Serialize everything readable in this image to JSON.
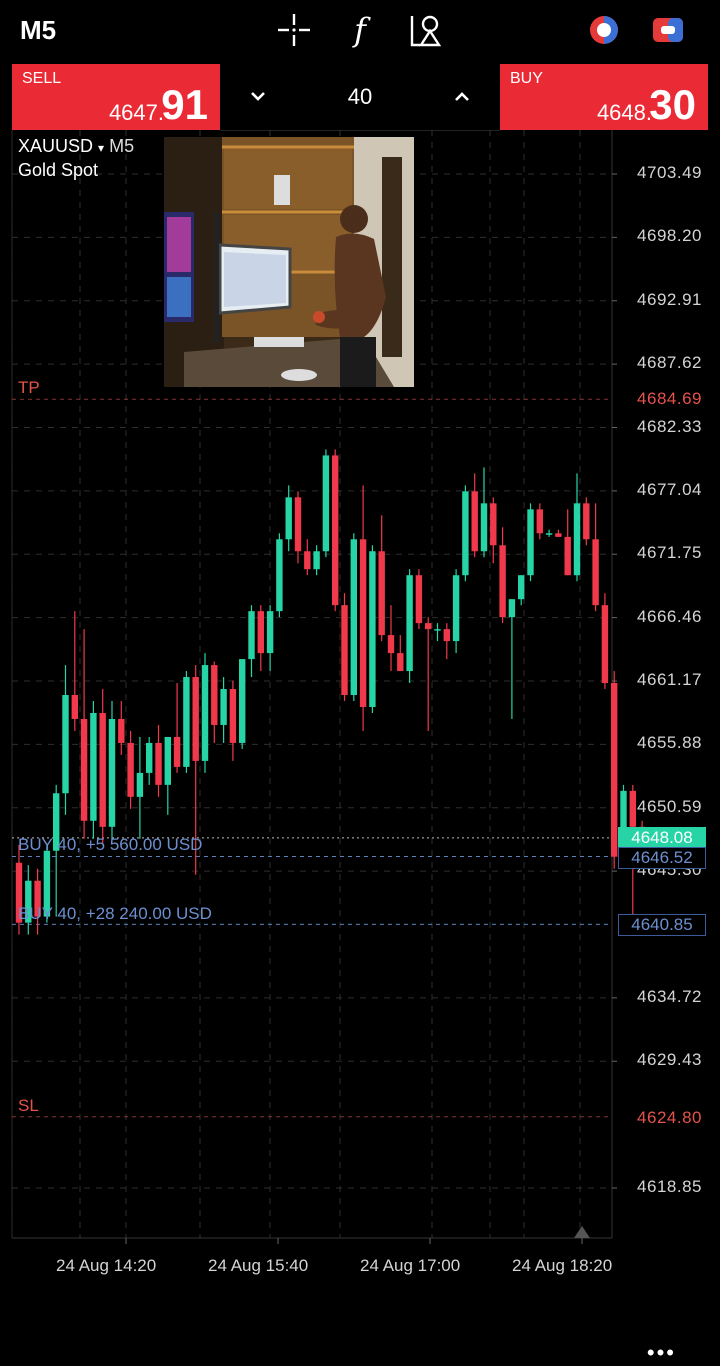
{
  "toolbar": {
    "timeframe": "M5",
    "icons": [
      "crosshair-icon",
      "indicators-icon",
      "objects-icon",
      "one-click-trading-icon",
      "chart-toggle-icon"
    ],
    "indicator_glyph": "f"
  },
  "trade_panel": {
    "sell": {
      "label": "SELL",
      "price_main": "4647.",
      "price_big": "91"
    },
    "buy": {
      "label": "BUY",
      "price_main": "4648.",
      "price_big": "30"
    },
    "volume": "40"
  },
  "chart": {
    "symbol": "XAUUSD",
    "symbol_caret": "▾",
    "period": "M5",
    "description": "Gold Spot",
    "price_axis": [
      "4703.49",
      "4698.20",
      "4692.91",
      "4687.62",
      "4682.33",
      "4677.04",
      "4671.75",
      "4666.46",
      "4661.17",
      "4655.88",
      "4650.59",
      "4645.30",
      "4634.72",
      "4629.43",
      "4618.85"
    ],
    "time_axis": [
      "24 Aug 14:20",
      "24 Aug 15:40",
      "24 Aug 17:00",
      "24 Aug 18:20"
    ],
    "levels": {
      "tp": {
        "label": "TP",
        "price": "4684.69"
      },
      "sl": {
        "label": "SL",
        "price": "4624.80"
      },
      "position1": {
        "label": "BUY 40, +5 560.00 USD",
        "price": "4646.52"
      },
      "position2": {
        "label": "BUY 40, +28 240.00 USD",
        "price": "4640.85"
      },
      "current": {
        "price": "4648.08"
      }
    },
    "colors": {
      "bull": "#26d4a6",
      "bear": "#f0394a",
      "tp_sl": "#e5534b",
      "position": "#5b7fbf"
    },
    "more": "•••"
  },
  "chart_data": {
    "type": "candlestick",
    "title": "XAUUSD",
    "subtitle": "Gold Spot",
    "timeframe": "M5",
    "ylim": [
      4615.0,
      4706.0
    ],
    "candles": [
      {
        "o": 4646.0,
        "h": 4647.5,
        "l": 4640.0,
        "c": 4641.0
      },
      {
        "o": 4641.0,
        "h": 4645.8,
        "l": 4640.0,
        "c": 4644.5
      },
      {
        "o": 4644.5,
        "h": 4645.5,
        "l": 4640.0,
        "c": 4641.5
      },
      {
        "o": 4641.5,
        "h": 4647.5,
        "l": 4641.0,
        "c": 4647.0
      },
      {
        "o": 4647.0,
        "h": 4652.5,
        "l": 4641.5,
        "c": 4651.8
      },
      {
        "o": 4651.8,
        "h": 4662.5,
        "l": 4650.0,
        "c": 4660.0
      },
      {
        "o": 4660.0,
        "h": 4667.0,
        "l": 4657.0,
        "c": 4658.0
      },
      {
        "o": 4658.0,
        "h": 4665.5,
        "l": 4648.0,
        "c": 4649.5
      },
      {
        "o": 4649.5,
        "h": 4659.5,
        "l": 4648.0,
        "c": 4658.5
      },
      {
        "o": 4658.5,
        "h": 4660.5,
        "l": 4647.5,
        "c": 4649.0
      },
      {
        "o": 4649.0,
        "h": 4659.5,
        "l": 4648.0,
        "c": 4658.0
      },
      {
        "o": 4658.0,
        "h": 4659.5,
        "l": 4655.0,
        "c": 4656.0
      },
      {
        "o": 4656.0,
        "h": 4657.0,
        "l": 4650.5,
        "c": 4651.5
      },
      {
        "o": 4651.5,
        "h": 4656.5,
        "l": 4648.0,
        "c": 4653.5
      },
      {
        "o": 4653.5,
        "h": 4656.5,
        "l": 4652.5,
        "c": 4656.0
      },
      {
        "o": 4656.0,
        "h": 4657.5,
        "l": 4651.5,
        "c": 4652.5
      },
      {
        "o": 4652.5,
        "h": 4656.5,
        "l": 4650.0,
        "c": 4656.5
      },
      {
        "o": 4656.5,
        "h": 4661.0,
        "l": 4653.5,
        "c": 4654.0
      },
      {
        "o": 4654.0,
        "h": 4662.0,
        "l": 4653.5,
        "c": 4661.5
      },
      {
        "o": 4661.5,
        "h": 4662.5,
        "l": 4645.0,
        "c": 4654.5
      },
      {
        "o": 4654.5,
        "h": 4663.5,
        "l": 4653.5,
        "c": 4662.5
      },
      {
        "o": 4662.5,
        "h": 4662.8,
        "l": 4656.0,
        "c": 4657.5
      },
      {
        "o": 4657.5,
        "h": 4661.5,
        "l": 4656.0,
        "c": 4660.5
      },
      {
        "o": 4660.5,
        "h": 4661.2,
        "l": 4654.5,
        "c": 4656.0
      },
      {
        "o": 4656.0,
        "h": 4663.0,
        "l": 4655.5,
        "c": 4663.0
      },
      {
        "o": 4663.0,
        "h": 4667.5,
        "l": 4661.5,
        "c": 4667.0
      },
      {
        "o": 4667.0,
        "h": 4667.5,
        "l": 4662.0,
        "c": 4663.5
      },
      {
        "o": 4663.5,
        "h": 4667.5,
        "l": 4662.0,
        "c": 4667.0
      },
      {
        "o": 4667.0,
        "h": 4673.5,
        "l": 4666.5,
        "c": 4673.0
      },
      {
        "o": 4673.0,
        "h": 4677.5,
        "l": 4672.0,
        "c": 4676.5
      },
      {
        "o": 4676.5,
        "h": 4677.0,
        "l": 4671.0,
        "c": 4672.0
      },
      {
        "o": 4672.0,
        "h": 4673.0,
        "l": 4670.0,
        "c": 4670.5
      },
      {
        "o": 4670.5,
        "h": 4672.5,
        "l": 4670.0,
        "c": 4672.0
      },
      {
        "o": 4672.0,
        "h": 4680.5,
        "l": 4671.5,
        "c": 4680.0
      },
      {
        "o": 4680.0,
        "h": 4680.5,
        "l": 4667.0,
        "c": 4667.5
      },
      {
        "o": 4667.5,
        "h": 4668.5,
        "l": 4659.5,
        "c": 4660.0
      },
      {
        "o": 4660.0,
        "h": 4673.5,
        "l": 4659.5,
        "c": 4673.0
      },
      {
        "o": 4673.0,
        "h": 4677.5,
        "l": 4657.0,
        "c": 4659.0
      },
      {
        "o": 4659.0,
        "h": 4672.5,
        "l": 4658.5,
        "c": 4672.0
      },
      {
        "o": 4672.0,
        "h": 4675.0,
        "l": 4664.5,
        "c": 4665.0
      },
      {
        "o": 4665.0,
        "h": 4667.5,
        "l": 4662.0,
        "c": 4663.5
      },
      {
        "o": 4663.5,
        "h": 4665.0,
        "l": 4662.0,
        "c": 4662.0
      },
      {
        "o": 4662.0,
        "h": 4670.5,
        "l": 4661.0,
        "c": 4670.0
      },
      {
        "o": 4670.0,
        "h": 4670.5,
        "l": 4665.5,
        "c": 4666.0
      },
      {
        "o": 4666.0,
        "h": 4666.5,
        "l": 4657.0,
        "c": 4665.5
      },
      {
        "o": 4665.5,
        "h": 4666.0,
        "l": 4664.5,
        "c": 4665.5
      },
      {
        "o": 4665.5,
        "h": 4666.0,
        "l": 4663.0,
        "c": 4664.5
      },
      {
        "o": 4664.5,
        "h": 4670.5,
        "l": 4663.5,
        "c": 4670.0
      },
      {
        "o": 4670.0,
        "h": 4677.5,
        "l": 4669.5,
        "c": 4677.0
      },
      {
        "o": 4677.0,
        "h": 4678.5,
        "l": 4671.5,
        "c": 4672.0
      },
      {
        "o": 4672.0,
        "h": 4679.0,
        "l": 4671.5,
        "c": 4676.0
      },
      {
        "o": 4676.0,
        "h": 4676.5,
        "l": 4671.0,
        "c": 4672.5
      },
      {
        "o": 4672.5,
        "h": 4674.0,
        "l": 4666.0,
        "c": 4666.5
      },
      {
        "o": 4666.5,
        "h": 4668.0,
        "l": 4658.0,
        "c": 4668.0
      },
      {
        "o": 4668.0,
        "h": 4670.0,
        "l": 4667.5,
        "c": 4670.0
      },
      {
        "o": 4670.0,
        "h": 4676.0,
        "l": 4669.5,
        "c": 4675.5
      },
      {
        "o": 4675.5,
        "h": 4676.0,
        "l": 4673.0,
        "c": 4673.5
      },
      {
        "o": 4673.5,
        "h": 4673.8,
        "l": 4673.2,
        "c": 4673.5
      },
      {
        "o": 4673.5,
        "h": 4673.8,
        "l": 4673.2,
        "c": 4673.2
      },
      {
        "o": 4673.2,
        "h": 4675.5,
        "l": 4670.0,
        "c": 4670.0
      },
      {
        "o": 4670.0,
        "h": 4678.5,
        "l": 4669.5,
        "c": 4676.0
      },
      {
        "o": 4676.0,
        "h": 4676.5,
        "l": 4672.5,
        "c": 4673.0
      },
      {
        "o": 4673.0,
        "h": 4676.0,
        "l": 4667.0,
        "c": 4667.5
      },
      {
        "o": 4667.5,
        "h": 4668.5,
        "l": 4660.5,
        "c": 4661.0
      },
      {
        "o": 4661.0,
        "h": 4662.0,
        "l": 4645.5,
        "c": 4646.5
      },
      {
        "o": 4646.5,
        "h": 4652.5,
        "l": 4646.0,
        "c": 4652.0
      },
      {
        "o": 4652.0,
        "h": 4652.5,
        "l": 4640.0,
        "c": 4649.0
      },
      {
        "o": 4649.0,
        "h": 4649.5,
        "l": 4647.5,
        "c": 4648.08
      }
    ]
  }
}
